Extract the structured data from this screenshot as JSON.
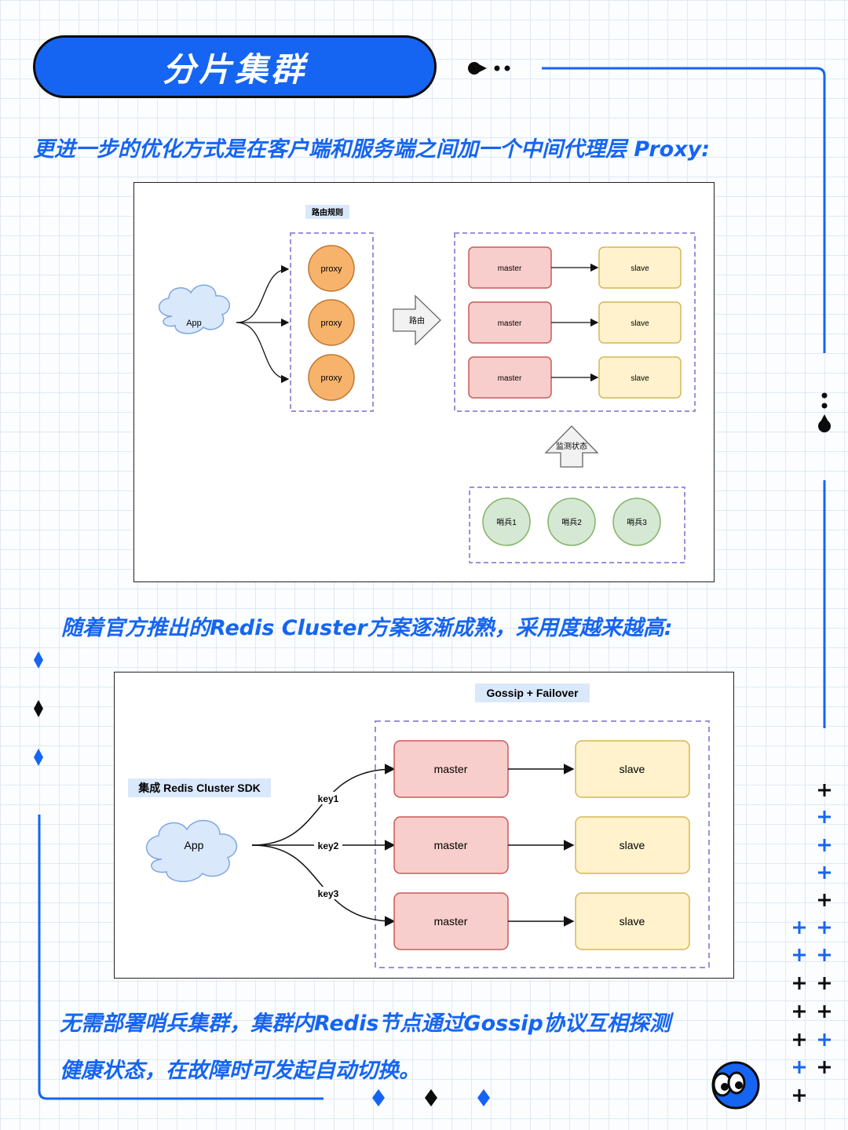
{
  "title": "分片集群",
  "paragraph1": "更进一步的优化方式是在客户端和服务端之间加一个中间代理层 Proxy:",
  "paragraph2": "随着官方推出的Redis Cluster方案逐渐成熟，采用度越来越高:",
  "paragraph3_line1": "无需部署哨兵集群，集群内Redis节点通过Gossip协议互相探测",
  "paragraph3_line2": "健康状态，在故障时可发起自动切换。",
  "diagram1": {
    "routing_rule_label": "路由规则",
    "app": "App",
    "proxies": [
      "proxy",
      "proxy",
      "proxy"
    ],
    "route_arrow": "路由",
    "masters": [
      "master",
      "master",
      "master"
    ],
    "slaves": [
      "slave",
      "slave",
      "slave"
    ],
    "monitor_arrow": "监测状态",
    "sentinels": [
      "哨兵1",
      "哨兵2",
      "哨兵3"
    ]
  },
  "diagram2": {
    "gossip_label": "Gossip + Failover",
    "sdk_label": "集成 Redis Cluster SDK",
    "app": "App",
    "keys": [
      "key1",
      "key2",
      "key3"
    ],
    "masters": [
      "master",
      "master",
      "master"
    ],
    "slaves": [
      "slave",
      "slave",
      "slave"
    ]
  },
  "colors": {
    "accent": "#1565f2",
    "master_fill": "#f8cecc",
    "master_stroke": "#c75b57",
    "slave_fill": "#fff2cc",
    "slave_stroke": "#d6b656",
    "proxy_fill": "#f7b36b",
    "sentinel_fill": "#d5e8d4",
    "cloud_fill": "#dae8fc",
    "dashed_border": "#9e8fdc"
  }
}
